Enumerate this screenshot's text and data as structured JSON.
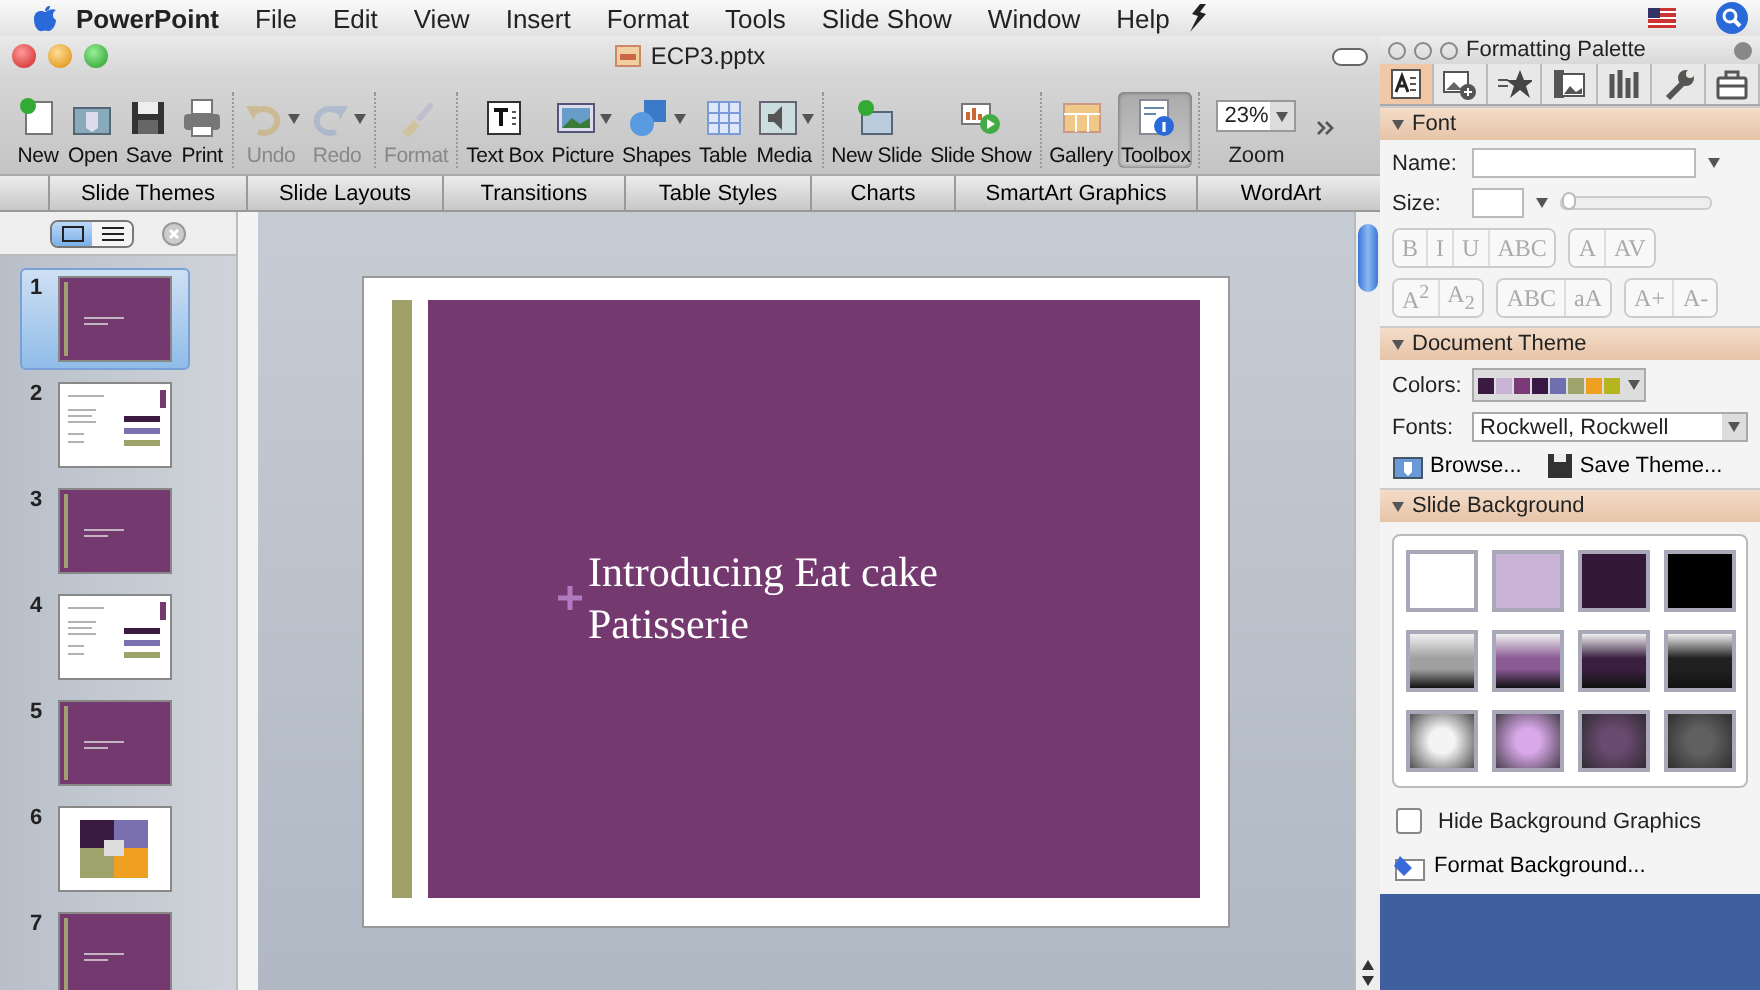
{
  "menu_bar": {
    "app": "PowerPoint",
    "items": [
      "File",
      "Edit",
      "View",
      "Insert",
      "Format",
      "Tools",
      "Slide Show",
      "Window",
      "Help"
    ]
  },
  "window": {
    "title": "ECP3.pptx"
  },
  "toolbar": [
    [
      {
        "label": "New",
        "kind": "new",
        "disabled": false,
        "pressed": false,
        "has_menu": false
      },
      {
        "label": "Open",
        "kind": "open",
        "disabled": false,
        "pressed": false,
        "has_menu": false
      },
      {
        "label": "Save",
        "kind": "save",
        "disabled": false,
        "pressed": false,
        "has_menu": false
      },
      {
        "label": "Print",
        "kind": "print",
        "disabled": false,
        "pressed": false,
        "has_menu": false
      }
    ],
    [
      {
        "label": "Undo",
        "kind": "undo",
        "disabled": true,
        "pressed": false,
        "has_menu": true
      },
      {
        "label": "Redo",
        "kind": "redo",
        "disabled": true,
        "pressed": false,
        "has_menu": true
      }
    ],
    [
      {
        "label": "Format",
        "kind": "brush",
        "disabled": true,
        "pressed": false,
        "has_menu": false
      }
    ],
    [
      {
        "label": "Text Box",
        "kind": "textbox",
        "disabled": false,
        "pressed": false,
        "has_menu": false
      },
      {
        "label": "Picture",
        "kind": "picture",
        "disabled": false,
        "pressed": false,
        "has_menu": true
      },
      {
        "label": "Shapes",
        "kind": "shapes",
        "disabled": false,
        "pressed": false,
        "has_menu": true
      },
      {
        "label": "Table",
        "kind": "table",
        "disabled": false,
        "pressed": false,
        "has_menu": false
      },
      {
        "label": "Media",
        "kind": "media",
        "disabled": false,
        "pressed": false,
        "has_menu": true
      }
    ],
    [
      {
        "label": "New Slide",
        "kind": "newslide",
        "disabled": false,
        "pressed": false,
        "has_menu": false
      },
      {
        "label": "Slide Show",
        "kind": "slideshow",
        "disabled": false,
        "pressed": false,
        "has_menu": false
      }
    ],
    [
      {
        "label": "Gallery",
        "kind": "gallery",
        "disabled": false,
        "pressed": false,
        "has_menu": false
      },
      {
        "label": "Toolbox",
        "kind": "toolbox",
        "disabled": false,
        "pressed": true,
        "has_menu": false
      }
    ]
  ],
  "zoom": {
    "value": "23%",
    "label": "Zoom"
  },
  "ribbon_tabs": [
    "Slide Themes",
    "Slide Layouts",
    "Transitions",
    "Table Styles",
    "Charts",
    "SmartArt Graphics",
    "WordArt"
  ],
  "view_toggle": [
    {
      "kind": "slides",
      "selected": true
    },
    {
      "kind": "outline",
      "selected": false
    }
  ],
  "slides": [
    {
      "number": "1",
      "kind": "title",
      "selected": true
    },
    {
      "number": "2",
      "kind": "content",
      "selected": false
    },
    {
      "number": "3",
      "kind": "title",
      "selected": false
    },
    {
      "number": "4",
      "kind": "content",
      "selected": false
    },
    {
      "number": "5",
      "kind": "title",
      "selected": false
    },
    {
      "number": "6",
      "kind": "diagram",
      "selected": false
    },
    {
      "number": "7",
      "kind": "title",
      "selected": false
    }
  ],
  "slide": {
    "title": "Introducing Eat cake Patisserie"
  },
  "palette": {
    "title": "Formatting Palette",
    "tabs": [
      {
        "kind": "text",
        "selected": true
      },
      {
        "kind": "picture",
        "selected": false
      },
      {
        "kind": "objects",
        "selected": false
      },
      {
        "kind": "media",
        "selected": false
      },
      {
        "kind": "chart",
        "selected": false
      },
      {
        "kind": "tools",
        "selected": false
      },
      {
        "kind": "toolbox",
        "selected": false
      }
    ],
    "font": {
      "header": "Font",
      "name_label": "Name:",
      "size_label": "Size:",
      "size_slider": {
        "level": 0
      },
      "style_buttons": [
        [
          "B",
          "I",
          "U",
          "ABC"
        ],
        [
          "A",
          "AV"
        ]
      ],
      "effect_buttons": [
        [
          "A$^{2}$",
          "A$_{2}$"
        ],
        [
          "ABC",
          "aA"
        ],
        [
          "A+",
          "A-"
        ]
      ]
    },
    "theme": {
      "header": "Document Theme",
      "colors_label": "Colors:",
      "colors": [
        {
          "color": "#3a1a40"
        },
        {
          "color": "#c9b3d6"
        },
        {
          "color": "#7a3a78"
        },
        {
          "color": "#3a1845"
        },
        {
          "color": "#6f6fb0"
        },
        {
          "color": "#9ea36c"
        },
        {
          "color": "#f0a020"
        },
        {
          "color": "#b5b520"
        }
      ],
      "fonts_label": "Fonts:",
      "fonts_value": "Rockwell, Rockwell",
      "browse": "Browse...",
      "save": "Save Theme..."
    },
    "background": {
      "header": "Slide Background",
      "styles": [
        {
          "kind": "solid",
          "color": "#ffffff"
        },
        {
          "kind": "solid",
          "color": "#c9b3d6"
        },
        {
          "kind": "solid",
          "color": "#341838"
        },
        {
          "kind": "solid",
          "color": "#000000"
        },
        {
          "kind": "linear",
          "color": "#a0a0a0"
        },
        {
          "kind": "linear",
          "color": "#8a5a94"
        },
        {
          "kind": "linear",
          "color": "#3a2040"
        },
        {
          "kind": "linear",
          "color": "#202020"
        },
        {
          "kind": "radial",
          "color": "#f4f4f4"
        },
        {
          "kind": "radial",
          "color": "#d8a8e8"
        },
        {
          "kind": "radial",
          "color": "#6a4a70"
        },
        {
          "kind": "radial",
          "color": "#606060"
        }
      ],
      "hide_graphics": {
        "label": "Hide Background Graphics",
        "checked": false
      },
      "format": "Format Background..."
    }
  }
}
